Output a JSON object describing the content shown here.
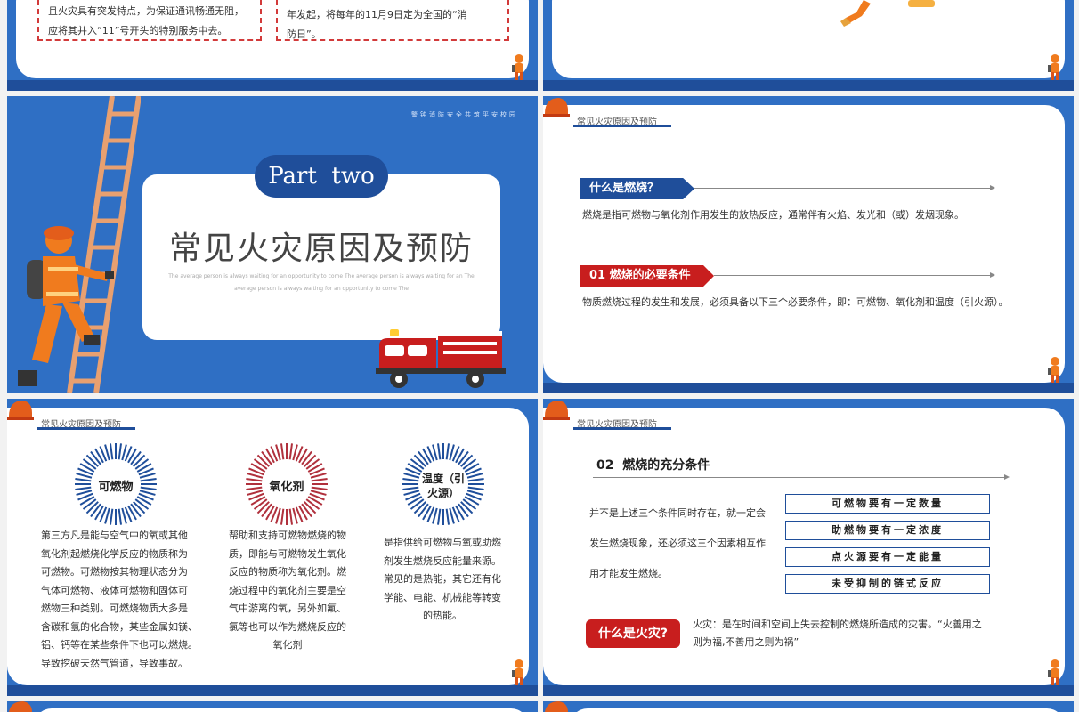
{
  "top_left": {
    "box1_lines": [
      "且火灾具有突发特点，为保证通讯畅通无阻，",
      "应将其并入“11”号开头的特别服务中去。"
    ],
    "box2_lines": [
      "年发起，将每年的11月9日定为全国的“消",
      "防日”。"
    ]
  },
  "part_slide": {
    "motto": "警钟消防安全共筑平安校园",
    "part_label": "Part  two",
    "title": "常见火灾原因及预防",
    "subtitle_lines": [
      "The average person is always waiting for an opportunity to come The average person is always waiting for an The",
      "average person is always waiting for an opportunity to come The"
    ]
  },
  "combustion_slide": {
    "section_label": "常见火灾原因及预防",
    "q1": "什么是燃烧？",
    "q1_text": "燃烧是指可燃物与氧化剂作用发生的放热反应，通常伴有火焰、发光和（或）发烟现象。",
    "q2": "01  燃烧的必要条件",
    "q2_text": "物质燃烧过程的发生和发展，必须具备以下三个必要条件，即：可燃物、氧化剂和温度（引火源）。"
  },
  "three_elements_slide": {
    "section_label": "常见火灾原因及预防",
    "items": [
      {
        "label": "可燃物",
        "color": "#1f4e9a",
        "lines": [
          "第三方凡是能与空气中的氧或其他",
          "氧化剂起燃烧化学反应的物质称为",
          "可燃物。可燃物按其物理状态分为",
          "气体可燃物、液体可燃物和固体可",
          "燃物三种类别。可燃烧物质大多是",
          "含碳和氢的化合物，某些金属如镁、",
          "铝、钙等在某些条件下也可以燃烧。",
          "导致挖破天然气管道，导致事故。"
        ]
      },
      {
        "label": "氧化剂",
        "color": "#b0303c",
        "lines": [
          "帮助和支持可燃物燃烧的物",
          "质，即能与可燃物发生氧化",
          "反应的物质称为氧化剂。燃",
          "烧过程中的氧化剂主要是空",
          "气中游离的氧，另外如氟、",
          "氯等也可以作为燃烧反应的",
          "氧化剂"
        ]
      },
      {
        "label_lines": [
          "温度（引",
          "火源）"
        ],
        "color": "#1f4e9a",
        "lines": [
          "是指供给可燃物与氧或助燃",
          "剂发生燃烧反应能量来源。",
          "常见的是热能，其它还有化",
          "学能、电能、机械能等转变",
          "的热能。"
        ]
      }
    ]
  },
  "sufficient_slide": {
    "section_label": "常见火灾原因及预防",
    "heading": "02  燃烧的充分条件",
    "lines": [
      "并不是上述三个条件同时存在，就一定会",
      "发生燃烧现象，还必须这三个因素相互作",
      "用才能发生燃烧。"
    ],
    "conditions": [
      "可燃物要有一定数量",
      "助燃物要有一定浓度",
      "点火源要有一定能量",
      "未受抑制的链式反应"
    ],
    "fire_q": "什么是火灾?",
    "fire_text_lines": [
      "火灾：是在时间和空间上失去控制的燃烧所造成的灾害。“火善用之",
      "则为福,不善用之则为祸”"
    ]
  },
  "colors": {
    "brand_blue": "#2f6fc4",
    "dark_blue": "#1f4e9a",
    "red": "#c81e1e"
  }
}
